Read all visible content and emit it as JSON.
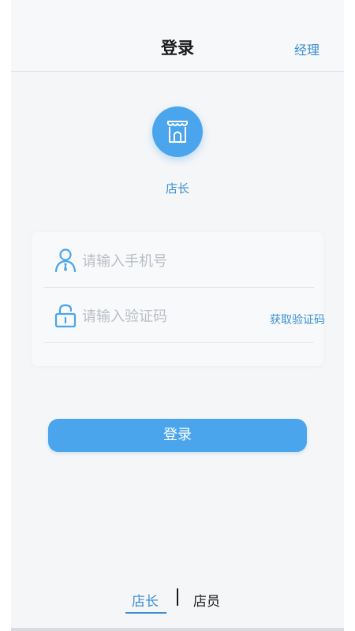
{
  "header": {
    "title": "登录",
    "right_action": "经理"
  },
  "role": {
    "icon": "storefront-icon",
    "label": "店长"
  },
  "form": {
    "phone": {
      "icon": "user-icon",
      "placeholder": "请输入手机号",
      "value": ""
    },
    "code": {
      "icon": "unlock-icon",
      "placeholder": "请输入验证码",
      "value": "",
      "action_label": "获取验证码"
    }
  },
  "login_button": {
    "label": "登录"
  },
  "role_switch": {
    "tabs": [
      {
        "label": "店长",
        "active": true
      },
      {
        "label": "店员",
        "active": false
      }
    ]
  },
  "colors": {
    "accent": "#4aa5ec",
    "accent_text": "#3b8fd1",
    "background": "#f5f6f8"
  }
}
